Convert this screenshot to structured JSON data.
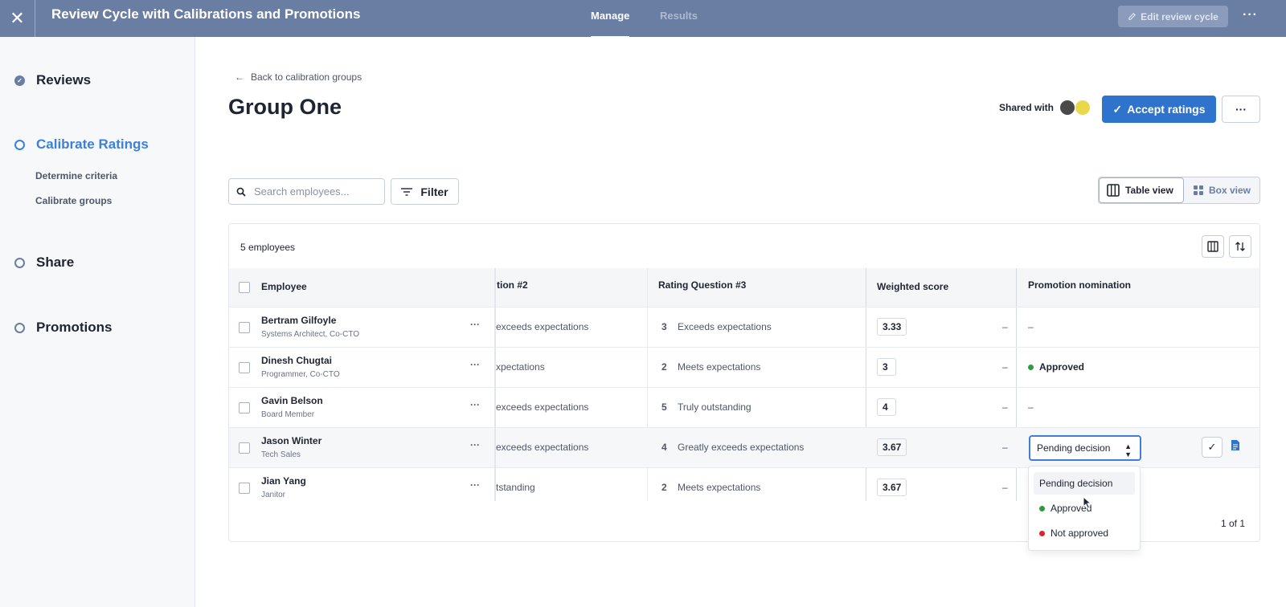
{
  "topbar": {
    "title": "Review Cycle with Calibrations and Promotions",
    "tabs": [
      "Manage",
      "Results"
    ],
    "edit_button": "Edit review cycle",
    "more": "···"
  },
  "sidebar": {
    "steps": [
      "Reviews",
      "Calibrate Ratings",
      "Share",
      "Promotions"
    ],
    "substeps": [
      "Determine criteria",
      "Calibrate groups"
    ]
  },
  "header": {
    "back_link": "Back to calibration groups",
    "title": "Group One",
    "shared_with": "Shared with",
    "accept_button": "Accept ratings",
    "more": "···"
  },
  "toolbar": {
    "search_placeholder": "Search employees...",
    "filter": "Filter",
    "table_view": "Table view",
    "box_view": "Box view"
  },
  "table": {
    "count": "5 employees",
    "columns": [
      "Employee",
      "tion #2",
      "Rating Question #3",
      "Weighted score",
      "Promotion nomination"
    ],
    "rows": [
      {
        "name": "Bertram Gilfoyle",
        "role": "Systems Architect, Co-CTO",
        "q2": "exceeds expectations",
        "q3_num": "3",
        "q3": "Exceeds expectations",
        "score": "3.33",
        "dash": "–",
        "promo": "–"
      },
      {
        "name": "Dinesh Chugtai",
        "role": "Programmer, Co-CTO",
        "q2": "xpectations",
        "q3_num": "2",
        "q3": "Meets expectations",
        "score": "3",
        "dash": "–",
        "promo": "Approved"
      },
      {
        "name": "Gavin Belson",
        "role": "Board Member",
        "q2": "exceeds expectations",
        "q3_num": "5",
        "q3": "Truly outstanding",
        "score": "4",
        "dash": "–",
        "promo": "–"
      },
      {
        "name": "Jason Winter",
        "role": "Tech Sales",
        "q2": "exceeds expectations",
        "q3_num": "4",
        "q3": "Greatly exceeds expectations",
        "score": "3.67",
        "dash": "–",
        "promo": "Pending decision"
      },
      {
        "name": "Jian Yang",
        "role": "Janitor",
        "q2": "tstanding",
        "q3_num": "2",
        "q3": "Meets expectations",
        "score": "3.67",
        "dash": "–",
        "promo": ""
      }
    ],
    "row_more": "···",
    "pager": "1 of 1"
  },
  "dropdown": {
    "options": [
      "Pending decision",
      "Approved",
      "Not approved"
    ],
    "selected": "Pending decision"
  },
  "colors": {
    "topbar": "#6a7da3",
    "accent": "#2f74cc",
    "approved": "#2e9c3c",
    "not_approved": "#e0232a"
  }
}
